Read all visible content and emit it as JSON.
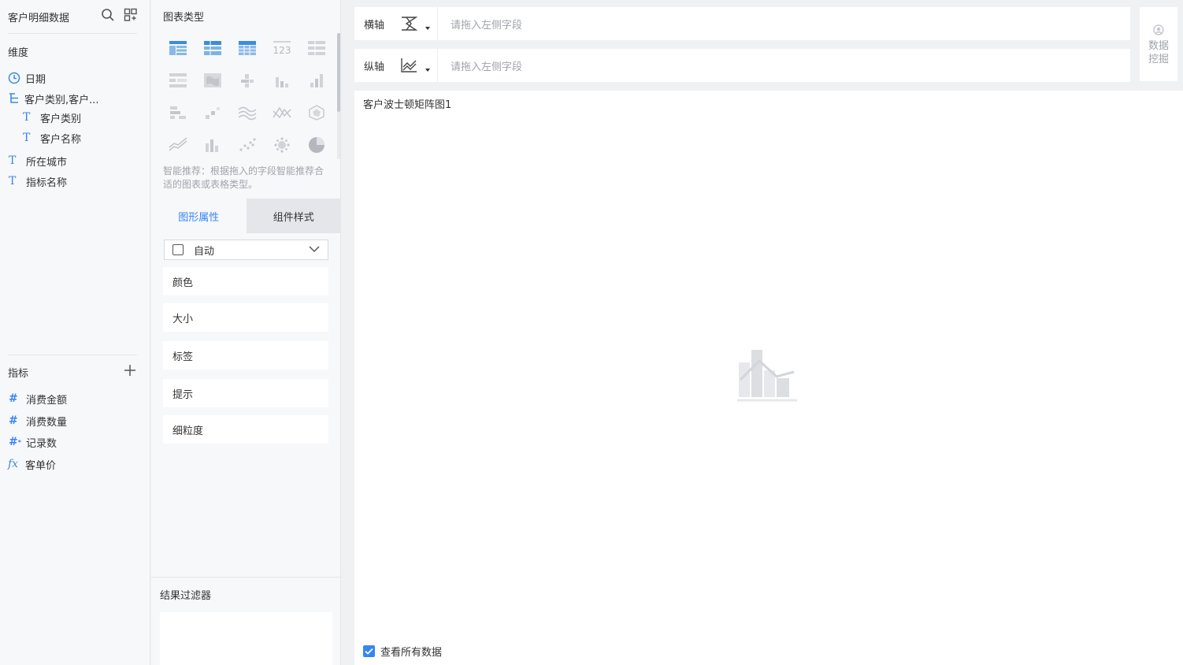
{
  "left_panel": {
    "dataset_title": "客户明细数据",
    "dimensions_label": "维度",
    "dimensions": {
      "date": "日期",
      "hierarchy": "客户类别,客户...",
      "sub_category": "客户类别",
      "sub_name": "客户名称",
      "city": "所在城市",
      "indicator_name": "指标名称"
    },
    "measures_label": "指标",
    "measures": {
      "amount": "消费金额",
      "quantity": "消费数量",
      "record_count": "记录数",
      "unit_price": "客单价"
    }
  },
  "mid_panel": {
    "chart_type_title": "图表类型",
    "smart_hint": "智能推荐：根据拖入的字段智能推荐合适的图表或表格类型。",
    "tabs": {
      "graphic_props": "图形属性",
      "component_style": "组件样式"
    },
    "auto_label": "自动",
    "properties": {
      "color": "颜色",
      "size": "大小",
      "label": "标签",
      "tooltip": "提示",
      "granularity": "细粒度"
    },
    "filter_title": "结果过滤器",
    "chart_types": [
      "grouped-table-icon",
      "detail-table-icon",
      "cross-table-icon",
      "kpi-number-icon",
      "list-table-icon",
      "heatmap-table-icon",
      "map-icon",
      "stacked-bar-icon",
      "bar-chart-icon",
      "column-chart-icon",
      "matrix-icon",
      "step-chart-icon",
      "streamgraph-icon",
      "parallel-icon",
      "radar-icon",
      "area-line-icon",
      "bar-line-icon",
      "scatter-icon",
      "bubble-icon",
      "pie-chart-icon"
    ]
  },
  "right_area": {
    "x_axis_label": "横轴",
    "y_axis_label": "纵轴",
    "x_axis_placeholder": "请拖入左侧字段",
    "y_axis_placeholder": "请拖入左侧字段",
    "mining_label": "数据挖掘",
    "chart_title": "客户波士顿矩阵图1",
    "view_all_label": "查看所有数据",
    "view_all_checked": true
  },
  "colors": {
    "accent": "#3685f2",
    "panel_bg": "#f7f8fa",
    "canvas_bg": "#ffffff",
    "muted_text": "#a0a4aa"
  }
}
